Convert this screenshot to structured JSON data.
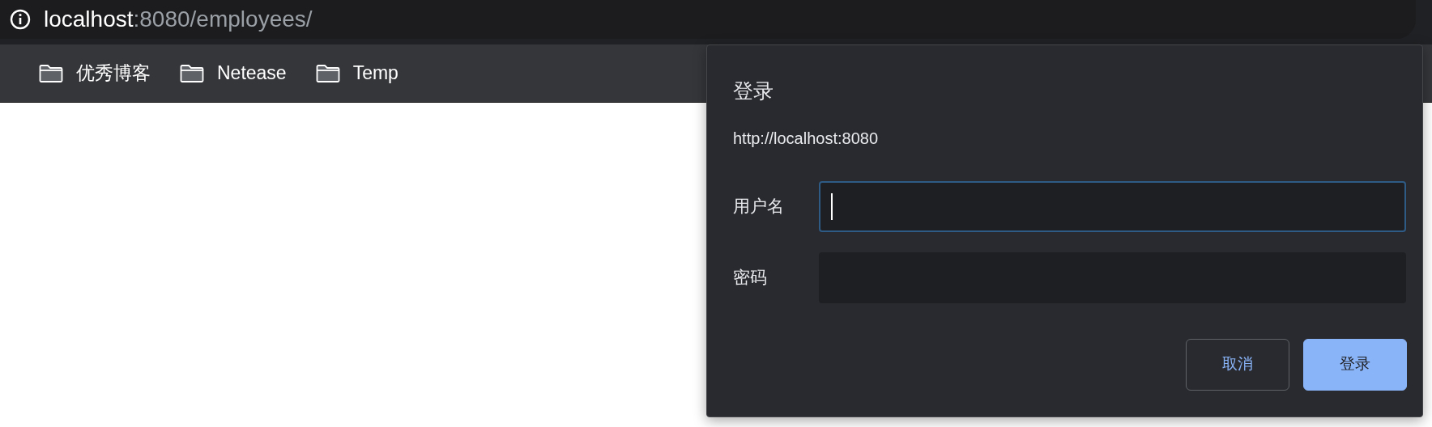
{
  "address_bar": {
    "host": "localhost",
    "path": ":8080/employees/"
  },
  "bookmarks": [
    {
      "label": "优秀博客"
    },
    {
      "label": "Netease"
    },
    {
      "label": "Temp"
    }
  ],
  "dialog": {
    "title": "登录",
    "origin": "http://localhost:8080",
    "fields": [
      {
        "label": "用户名",
        "focused": true
      },
      {
        "label": "密码",
        "focused": false
      }
    ],
    "buttons": [
      {
        "label": "取消",
        "primary": false
      },
      {
        "label": "登录",
        "primary": true
      }
    ]
  }
}
